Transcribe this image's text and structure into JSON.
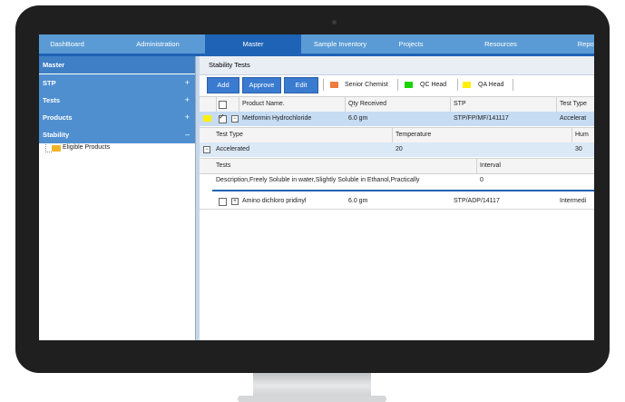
{
  "nav": {
    "tabs": [
      {
        "label": "DashBoard"
      },
      {
        "label": "Administration"
      },
      {
        "label": "Master"
      },
      {
        "label": "Sample Inventory"
      },
      {
        "label": "Projects"
      },
      {
        "label": "Resources"
      },
      {
        "label": "Report"
      }
    ],
    "active": "Master"
  },
  "sidebar": {
    "title": "Master",
    "items": [
      {
        "label": "STP",
        "toggle": "+"
      },
      {
        "label": "Tests",
        "toggle": "+"
      },
      {
        "label": "Products",
        "toggle": "+"
      },
      {
        "label": "Stability",
        "toggle": "–"
      }
    ],
    "child": "Eligible Products"
  },
  "main": {
    "title": "Stability Tests",
    "toolbar": {
      "add": "Add",
      "approve": "Approve",
      "edit": "Edit"
    },
    "legend": [
      {
        "label": "Senior Chemist",
        "color": "#f07b3f"
      },
      {
        "label": "QC Head",
        "color": "#19d400"
      },
      {
        "label": "QA Head",
        "color": "#ffef00"
      }
    ],
    "grid": {
      "headers": {
        "product": "Product Name.",
        "qty": "Qty Received",
        "stp": "STP",
        "type": "Test Type"
      },
      "rows": [
        {
          "product": "Metformin Hydrochloride",
          "qty": "6.0 gm",
          "stp": "STP/FP/MF/141117",
          "type": "Accelerat",
          "marker_color": "#ffef00"
        },
        {
          "product": "Amino dichloro pridinyl",
          "qty": "6.0 gm",
          "stp": "STP/ADP/14117",
          "type": "Intermedi"
        }
      ],
      "sub": {
        "headers": {
          "type": "Test Type",
          "temp": "Temperature",
          "hum": "Hum"
        },
        "row": {
          "type": "Accelerated",
          "temp": "20",
          "hum": "30"
        },
        "tests_header": {
          "tests": "Tests",
          "interval": "Interval"
        },
        "test_row": {
          "tests": "Description,Freely Soluble in water,Slightly Soluble in Ethanol,Practically",
          "interval": "0"
        }
      }
    }
  }
}
